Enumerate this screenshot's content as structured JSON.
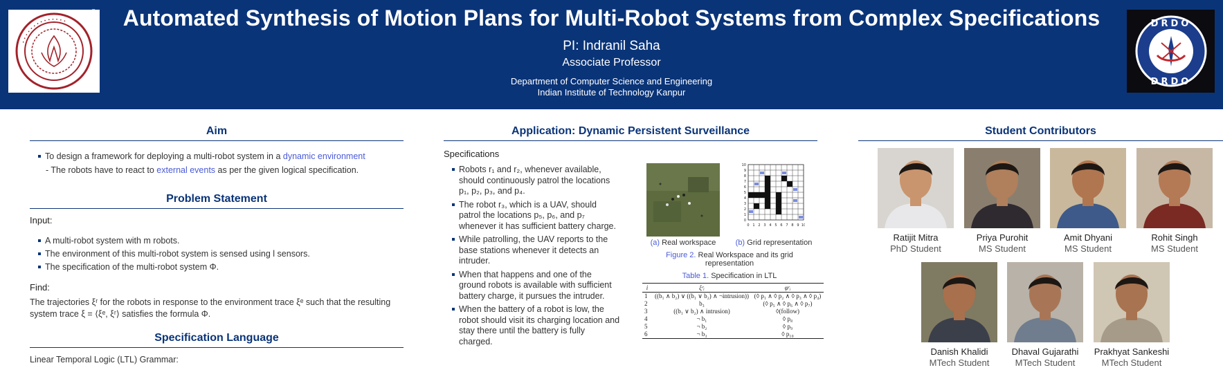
{
  "header": {
    "title": "Automated Synthesis of Motion Plans for Multi-Robot Systems from Complex Specifications",
    "pi": "PI: Indranil Saha",
    "role": "Associate Professor",
    "department": "Department of Computer Science and Engineering",
    "institute": "Indian Institute of Technology Kanpur",
    "reg_mark": "®",
    "left_logo": {
      "icon": "iit-kanpur-logo",
      "lettering": "INDIAN INSTITUTE OF TECHNOLOGY KANPUR"
    },
    "right_logo": {
      "icon": "drdo-logo",
      "lettering_top": "DRDO",
      "lettering_bottom": "DRDO"
    }
  },
  "aim": {
    "heading": "Aim",
    "bullet_pre": "To design a framework for deploying a multi-robot system in a ",
    "bullet_link": "dynamic environment",
    "sub_pre": "- The robots have to react to ",
    "sub_link": "external events",
    "sub_post": " as per the given logical specification."
  },
  "problem": {
    "heading": "Problem Statement",
    "input_label": "Input:",
    "items": [
      "A multi-robot system with m robots.",
      "The environment of this multi-robot system is sensed using l sensors.",
      "The specification of the multi-robot system Φ."
    ],
    "find_label": "Find:",
    "find_line1": "The trajectories ξʳ for the robots in response to the environment trace ξᵉ such that the resulting",
    "find_line2": "system trace ξ = ⟨ξᵉ, ξʳ⟩ satisfies the formula Φ."
  },
  "spec_language": {
    "heading": "Specification Language",
    "line": "Linear Temporal Logic (LTL) Grammar:"
  },
  "application": {
    "heading": "Application: Dynamic Persistent Surveillance",
    "spec_label": "Specifications",
    "items": [
      "Robots r₁ and r₂, whenever available, should continuously patrol the locations p₁, p₂, p₃, and p₄.",
      "The robot r₃, which is a UAV, should patrol the locations p₅, p₆, and p₇ whenever it has sufficient battery charge.",
      "While patrolling, the UAV reports to the base stations whenever it detects an intruder.",
      "When that happens and one of the ground robots is available with sufficient battery charge, it pursues the intruder.",
      "When the battery of a robot is low, the robot should visit its charging location and stay there until the battery is fully charged."
    ],
    "fig_a_label": "(a)",
    "fig_a_text": "Real workspace",
    "fig_b_label": "(b)",
    "fig_b_text": "Grid representation",
    "fig2_label": "Figure 2.",
    "fig2_text": "Real Workspace and its grid representation",
    "table_label": "Table 1.",
    "table_text": "Specification in LTL",
    "table_headers": [
      "i",
      "ξᵉᵢ",
      "φʳᵢ"
    ],
    "table_rows": [
      [
        "1",
        "((b₁ ∧ b₂) ∨ ((b₁ ∨ b₂) ∧ ¬intrusion))",
        "(◊ p₁ ∧ ◊ p₂ ∧ ◊ p₃ ∧ ◊ p₄)"
      ],
      [
        "2",
        "b₃",
        "(◊ p₅ ∧ ◊ p₆ ∧ ◊ p₇)"
      ],
      [
        "3",
        "((b₁ ∨ b₂) ∧ intrusion)",
        "◊(follow)"
      ],
      [
        "4",
        "¬ b₁",
        "◊ p₈"
      ],
      [
        "5",
        "¬ b₂",
        "◊ p₉"
      ],
      [
        "6",
        "¬ b₃",
        "◊ p₁₀"
      ]
    ],
    "grid_ticks": [
      "0",
      "1",
      "2",
      "3",
      "4",
      "5",
      "6",
      "7",
      "8",
      "9",
      "10"
    ]
  },
  "students": {
    "heading": "Student Contributors",
    "people": [
      {
        "name": "Ratijit Mitra",
        "role": "PhD Student",
        "skin": "#c9956e",
        "bg": "#d8d5d0",
        "shirt": "#e8e8ea"
      },
      {
        "name": "Priya Purohit",
        "role": "MS Student",
        "skin": "#b07f5c",
        "bg": "#8a7f6f",
        "shirt": "#2f2a30"
      },
      {
        "name": "Amit Dhyani",
        "role": "MS Student",
        "skin": "#b07650",
        "bg": "#c9b89c",
        "shirt": "#3d5a8a"
      },
      {
        "name": "Rohit Singh",
        "role": "MS Student",
        "skin": "#b47a55",
        "bg": "#c7b8a6",
        "shirt": "#7a2a22"
      },
      {
        "name": "Danish Khalidi",
        "role": "MTech Student",
        "skin": "#a8704c",
        "bg": "#7f7a62",
        "shirt": "#3b3f4a"
      },
      {
        "name": "Dhaval Gujarathi",
        "role": "MTech Student",
        "skin": "#a87656",
        "bg": "#b8b2a8",
        "shirt": "#6f7d8e"
      },
      {
        "name": "Prakhyat Sankeshi",
        "role": "MTech Student",
        "skin": "#a87350",
        "bg": "#cfc6b4",
        "shirt": "#a69a88"
      }
    ]
  },
  "colors": {
    "header_bg": "#0a3478",
    "accent": "#0a3478",
    "link": "#4a5bd6"
  }
}
